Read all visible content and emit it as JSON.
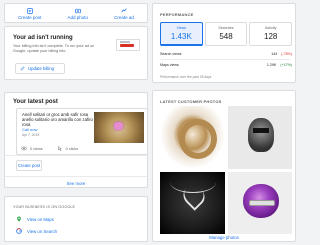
{
  "actions": {
    "create_post": "Create post",
    "add_photo": "Add photo",
    "create_ad": "Create ad"
  },
  "ad": {
    "title": "Your ad isn't running",
    "description": "Your billing info isn't complete. To run your ad on Google, update your billing info.",
    "button": "Update billing"
  },
  "post": {
    "title": "Your latest post",
    "text": "Anell solitari or groc amb safir rosa anello solitario oro amarillo con zafiro rosa",
    "call": "Call now",
    "date": "Apr 7, 2019",
    "views": "0 views",
    "clicks": "0 clicks",
    "create_button": "Create post",
    "see_more": "See more"
  },
  "google": {
    "title": "YOUR BUSINESS IS ON GOOGLE",
    "maps": "View on Maps",
    "search": "View on Search"
  },
  "performance": {
    "title": "PERFORMANCE",
    "metrics": [
      {
        "label": "Views",
        "value": "1.43K"
      },
      {
        "label": "Searches",
        "value": "548"
      },
      {
        "label": "Activity",
        "value": "128"
      }
    ],
    "rows": [
      {
        "label": "Search views",
        "value": "144",
        "change": "(-78%)",
        "trend": "bad"
      },
      {
        "label": "Maps views",
        "value": "1.29K",
        "change": "(+17%)",
        "trend": "good"
      }
    ],
    "footer": "Performance over the past 28 days"
  },
  "photos": {
    "title": "LATEST CUSTOMER PHOTOS",
    "manage": "Manage photos"
  },
  "colors": {
    "accent": "#1a73e8",
    "negative": "#d93025",
    "positive": "#188038"
  }
}
